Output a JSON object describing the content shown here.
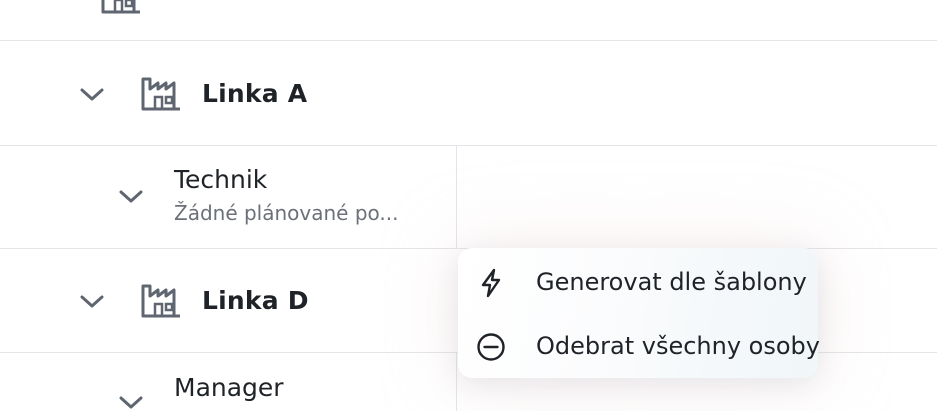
{
  "rows": {
    "linka_a": {
      "label": "Linka A"
    },
    "technik": {
      "name": "Technik",
      "subtitle": "Žádné plánované po..."
    },
    "linka_d": {
      "label": "Linka D"
    },
    "manager": {
      "name": "Manager"
    }
  },
  "context_menu": {
    "items": [
      {
        "label": "Generovat dle šablony",
        "icon": "lightning-icon"
      },
      {
        "label": "Odebrat všechny osoby",
        "icon": "minus-circle-icon"
      }
    ]
  },
  "colors": {
    "icon": "#5f6670",
    "divider": "#e3e5e8",
    "text": "#1f2328",
    "muted": "#6b7079"
  }
}
